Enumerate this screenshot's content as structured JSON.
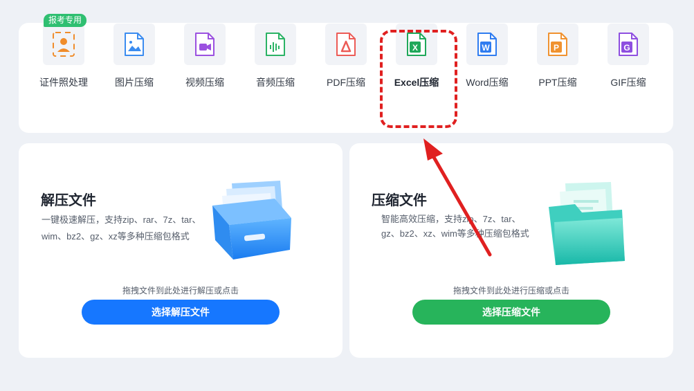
{
  "tools": [
    {
      "id": "id-photo",
      "label": "证件照处理",
      "icon": "id-photo-icon",
      "color": "#f08c2a",
      "glyph": "person"
    },
    {
      "id": "image",
      "label": "图片压缩",
      "icon": "image-file-icon",
      "color": "#3b8cf0",
      "glyph": "image"
    },
    {
      "id": "video",
      "label": "视频压缩",
      "icon": "video-file-icon",
      "color": "#9b51e0",
      "glyph": "video"
    },
    {
      "id": "audio",
      "label": "音频压缩",
      "icon": "audio-file-icon",
      "color": "#2bb365",
      "glyph": "audio"
    },
    {
      "id": "pdf",
      "label": "PDF压缩",
      "icon": "pdf-file-icon",
      "color": "#ec5b56",
      "glyph": "pdf"
    },
    {
      "id": "excel",
      "label": "Excel压缩",
      "icon": "excel-file-icon",
      "color": "#1fa85a",
      "glyph": "X"
    },
    {
      "id": "word",
      "label": "Word压缩",
      "icon": "word-file-icon",
      "color": "#2f7cf0",
      "glyph": "W"
    },
    {
      "id": "ppt",
      "label": "PPT压缩",
      "icon": "ppt-file-icon",
      "color": "#f0922f",
      "glyph": "P"
    },
    {
      "id": "gif",
      "label": "GIF压缩",
      "icon": "gif-file-icon",
      "color": "#8e4fe0",
      "glyph": "G"
    }
  ],
  "badge": "报考专用",
  "decompress": {
    "title": "解压文件",
    "desc": "一键极速解压，支持zip、rar、7z、tar、wim、bz2、gz、xz等多种压缩包格式",
    "hint": "拖拽文件到此处进行解压或点击",
    "button": "选择解压文件",
    "button_color": "#1677ff"
  },
  "compress": {
    "title": "压缩文件",
    "desc": "智能高效压缩，支持zip、7z、tar、gz、bz2、xz、wim等多种压缩包格式",
    "hint": "拖拽文件到此处进行压缩或点击",
    "button": "选择压缩文件",
    "button_color": "#27b45b"
  },
  "annotation_color": "#e02020"
}
